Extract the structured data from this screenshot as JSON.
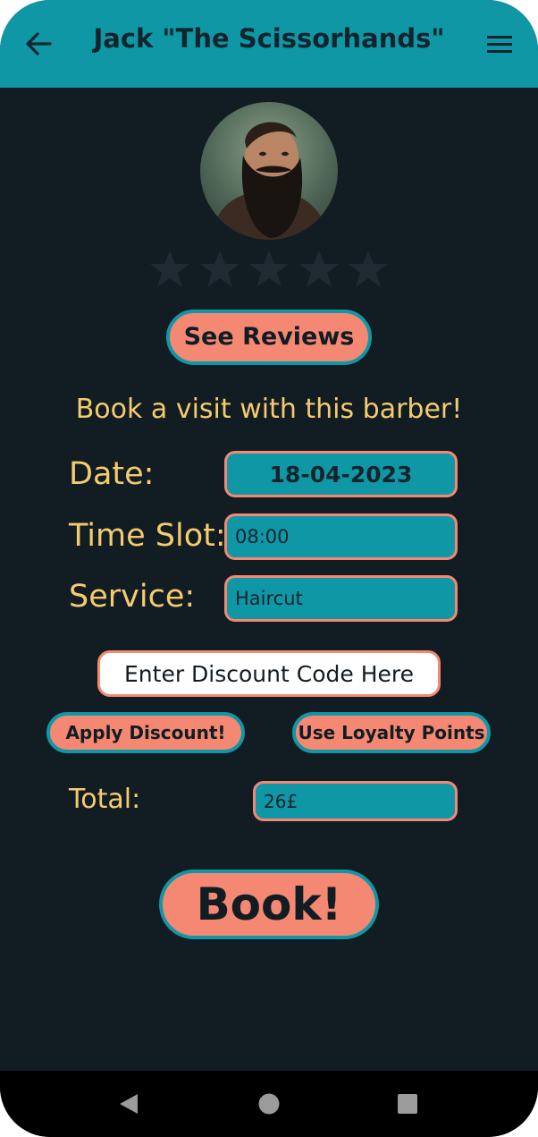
{
  "header": {
    "title": "Jack \"The Scissorhands\"",
    "back_icon": "arrow-left-icon",
    "menu_icon": "hamburger-menu-icon"
  },
  "profile": {
    "avatar": "barber-avatar",
    "rating": 0,
    "rating_max": 5
  },
  "reviews_button": {
    "label": "See Reviews"
  },
  "booking": {
    "heading": "Book a visit with this barber!",
    "date_label": "Date:",
    "date_value": "18-04-2023",
    "time_label": "Time Slot:",
    "time_value": "08:00",
    "service_label": "Service:",
    "service_value": "Haircut"
  },
  "discount": {
    "placeholder": "Enter Discount Code Here",
    "apply_label": "Apply Discount!",
    "loyalty_label": "Use Loyalty Points"
  },
  "total": {
    "label": "Total:",
    "value": "26£"
  },
  "book_button": {
    "label": "Book!"
  },
  "colors": {
    "background": "#121c23",
    "accent_teal": "#0f97a6",
    "accent_salmon": "#f48872",
    "text_yellow": "#f4cc6e"
  },
  "system_nav": {
    "back_icon": "nav-back-triangle-icon",
    "home_icon": "nav-home-circle-icon",
    "recents_icon": "nav-recents-square-icon"
  }
}
